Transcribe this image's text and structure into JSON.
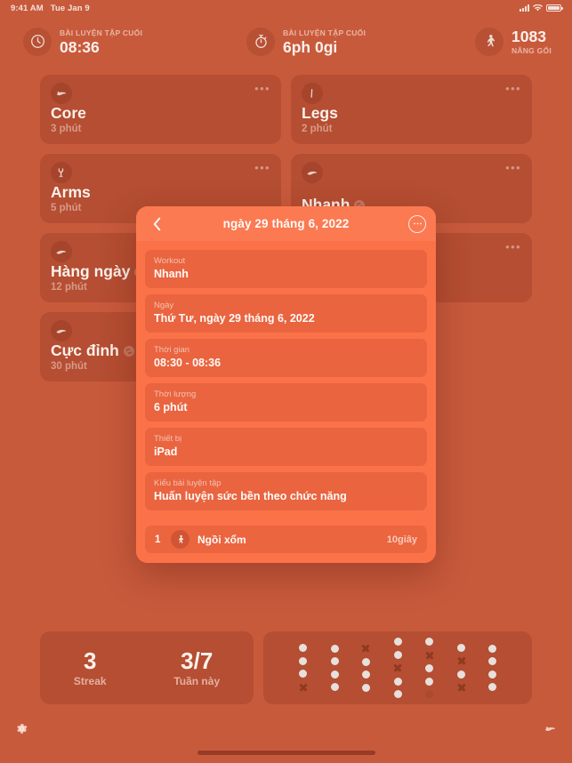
{
  "status_bar": {
    "time": "9:41 AM",
    "date": "Tue Jan 9",
    "cellular_icon": "signal-bars-icon",
    "wifi_icon": "wifi-icon",
    "battery_icon": "battery-icon"
  },
  "top_stats": [
    {
      "icon": "clock-icon",
      "label": "BÀI LUYỆN TẬP CUỐI",
      "value": "08:36",
      "order": "label-first"
    },
    {
      "icon": "stopwatch-icon",
      "label": "BÀI LUYỆN TẬP CUỐI",
      "value": "6ph 0gi",
      "order": "label-first"
    },
    {
      "icon": "runner-icon",
      "label": "NÂNG GỐI",
      "value": "1083",
      "order": "value-first"
    }
  ],
  "workout_cards": [
    {
      "icon": "core-icon",
      "title": "Core",
      "duration": "3 phút",
      "repeat": false,
      "more": "•••"
    },
    {
      "icon": "legs-icon",
      "title": "Legs",
      "duration": "2 phút",
      "repeat": false,
      "more": "•••"
    },
    {
      "icon": "arms-icon",
      "title": "Arms",
      "duration": "5 phút",
      "repeat": false,
      "more": "•••"
    },
    {
      "icon": "quick-icon",
      "title": "Nhanh",
      "duration": "",
      "repeat": true,
      "more": "•••"
    },
    {
      "icon": "daily-icon",
      "title": "Hàng ngày",
      "duration": "12 phút",
      "repeat": true,
      "more": "•••"
    },
    {
      "icon": "peak-icon",
      "title": "",
      "duration": "",
      "repeat": false,
      "more": "•••"
    },
    {
      "icon": "peak-icon",
      "title": "Cực đỉnh",
      "duration": "30 phút",
      "repeat": true,
      "more": ""
    }
  ],
  "streak": {
    "count": "3",
    "count_label": "Streak",
    "week": "3/7",
    "week_label": "Tuần này"
  },
  "activity_grid": {
    "columns": [
      [
        "dot",
        "dot",
        "dot",
        "x"
      ],
      [
        "dot",
        "dot",
        "dot",
        "dot"
      ],
      [
        "x",
        "dot",
        "dot",
        "dot"
      ],
      [
        "dot",
        "dot",
        "x",
        "dot",
        "dot"
      ],
      [
        "dot",
        "x",
        "dot",
        "dot",
        "faint"
      ],
      [
        "dot",
        "x",
        "dot",
        "x"
      ],
      [
        "dot",
        "dot",
        "dot",
        "dot"
      ]
    ]
  },
  "footer": {
    "settings_icon": "gear-icon",
    "core-icon": "core-icon",
    "home_indicator": "home-indicator"
  },
  "modal": {
    "back_icon": "chevron-left-icon",
    "title": "ngày 29 tháng 6, 2022",
    "menu_icon": "ellipsis-circle-icon",
    "fields": [
      {
        "label": "Workout",
        "value": "Nhanh"
      },
      {
        "label": "Ngày",
        "value": "Thứ Tư, ngày 29 tháng 6, 2022"
      },
      {
        "label": "Thời gian",
        "value": "08:30 - 08:36"
      },
      {
        "label": "Thời lượng",
        "value": "6 phút"
      },
      {
        "label": "Thiết bị",
        "value": "iPad"
      },
      {
        "label": "Kiểu bài luyện tập",
        "value": "Huấn luyện sức bền theo chức năng"
      }
    ],
    "exercises": [
      {
        "index": "1",
        "icon": "squat-icon",
        "name": "Ngồi xổm",
        "duration": "10giây"
      }
    ]
  },
  "colors": {
    "background": "#c85a3c",
    "card": "rgba(112,36,20,0.22)",
    "modal": "#fb7249",
    "modal_header": "#fb7a52",
    "text": "#fbf1ec",
    "dot": "#e7e0dc",
    "x": "#8f3a20"
  }
}
